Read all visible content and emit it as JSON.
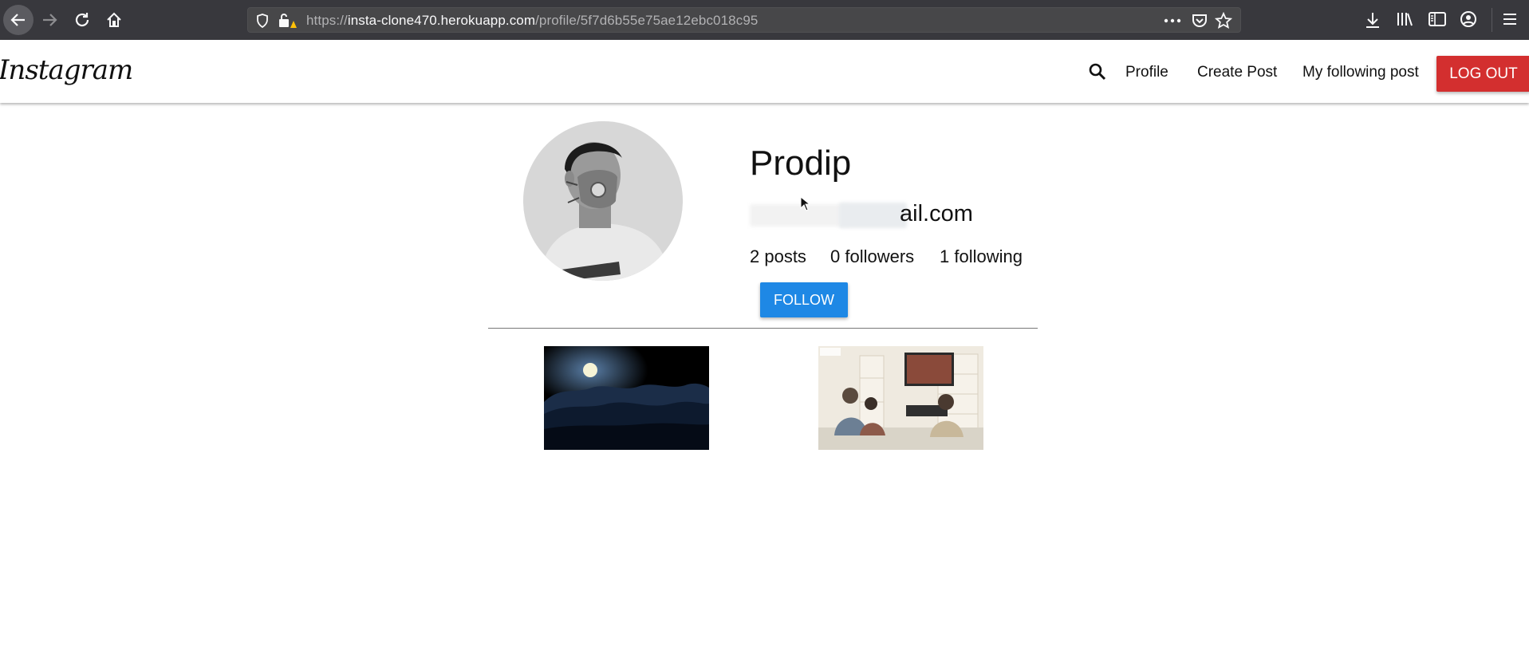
{
  "browser": {
    "url_prefix": "https://",
    "url_host": "insta-clone470.herokuapp.com",
    "url_path": "/profile/5f7d6b55e75ae12ebc018c95",
    "icons": [
      "back-icon",
      "forward-icon",
      "reload-icon",
      "home-icon",
      "shield-icon",
      "lock-warning-icon",
      "more-icon",
      "pocket-icon",
      "star-icon",
      "download-icon",
      "library-icon",
      "sidebar-icon",
      "account-icon",
      "menu-icon"
    ]
  },
  "nav": {
    "logo": "Instagram",
    "links": [
      "Profile",
      "Create Post",
      "My following post"
    ],
    "logout": "LOG OUT"
  },
  "profile": {
    "name": "Prodip",
    "email_visible": "ail.com",
    "stats": {
      "posts": "2 posts",
      "followers": "0 followers",
      "following": "1 following"
    },
    "follow_button": "FOLLOW"
  },
  "colors": {
    "chrome": "#38383d",
    "logout": "#d32f2f",
    "follow": "#1e88e5"
  }
}
